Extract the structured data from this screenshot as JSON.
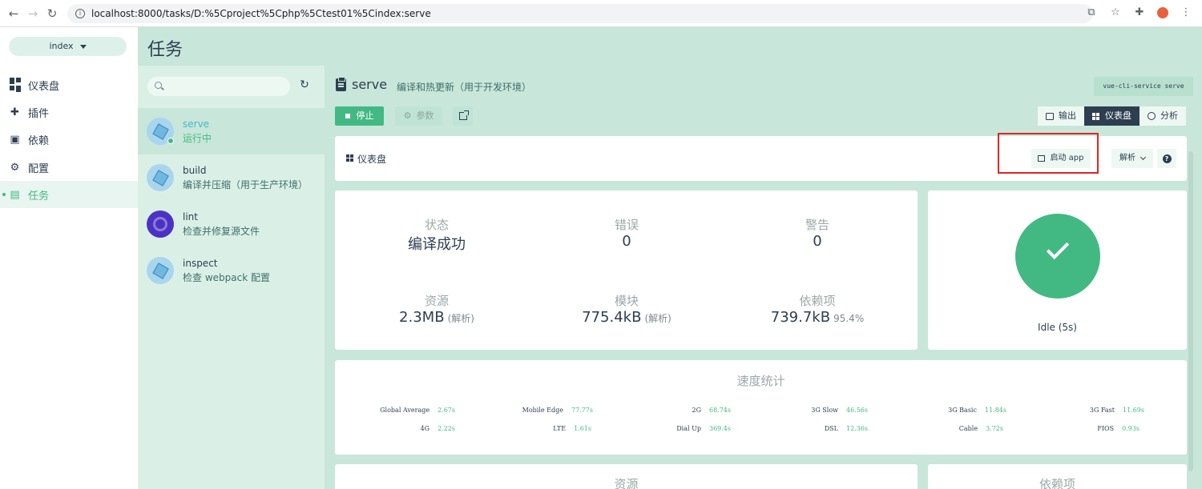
{
  "browser": {
    "url": "localhost:8000/tasks/D:%5Cproject%5Cphp%5Ctest01%5Cindex:serve"
  },
  "sidebar": {
    "project": "index",
    "items": [
      {
        "label": "仪表盘",
        "icon": "dashboard-icon"
      },
      {
        "label": "插件",
        "icon": "puzzle-icon"
      },
      {
        "label": "依赖",
        "icon": "library-icon"
      },
      {
        "label": "配置",
        "icon": "settings-icon"
      },
      {
        "label": "任务",
        "icon": "assignment-icon",
        "active": true
      }
    ]
  },
  "header": {
    "title": "任务"
  },
  "tasks": [
    {
      "name": "serve",
      "desc": "运行中",
      "active": true
    },
    {
      "name": "build",
      "desc": "编译并压缩（用于生产环境）"
    },
    {
      "name": "lint",
      "desc": "检查并修复源文件"
    },
    {
      "name": "inspect",
      "desc": "检查 webpack 配置"
    }
  ],
  "task": {
    "name": "serve",
    "desc": "编译和热更新（用于开发环境）",
    "command": "vue-cli-service serve",
    "stop_label": "停止",
    "params_label": "参数"
  },
  "view_tabs": [
    {
      "label": "输出"
    },
    {
      "label": "仪表盘",
      "active": true
    },
    {
      "label": "分析"
    }
  ],
  "dashboard": {
    "title": "仪表盘",
    "launch_label": "启动 app",
    "analyze_label": "解析",
    "highlight_color": "#e02424"
  },
  "stats": {
    "status": {
      "label": "状态",
      "value": "编译成功"
    },
    "errors": {
      "label": "错误",
      "value": "0"
    },
    "warnings": {
      "label": "警告",
      "value": "0"
    },
    "assets": {
      "label": "资源",
      "value": "2.3MB",
      "sub": "(解析)"
    },
    "modules": {
      "label": "模块",
      "value": "775.4kB",
      "sub": "(解析)"
    },
    "deps": {
      "label": "依赖项",
      "value": "739.7kB",
      "sub": "95.4%"
    }
  },
  "status_card": {
    "text": "Idle (5s)",
    "color": "#42b983"
  },
  "speed": {
    "title": "速度统计",
    "rows": [
      [
        {
          "name": "Global Average",
          "value": "2.67s"
        },
        {
          "name": "Mobile Edge",
          "value": "77.77s"
        },
        {
          "name": "2G",
          "value": "68.74s"
        },
        {
          "name": "3G Slow",
          "value": "46.56s"
        },
        {
          "name": "3G Basic",
          "value": "11.84s"
        },
        {
          "name": "3G Fast",
          "value": "11.69s"
        }
      ],
      [
        {
          "name": "4G",
          "value": "2.22s"
        },
        {
          "name": "LTE",
          "value": "1.61s"
        },
        {
          "name": "Dial Up",
          "value": "369.4s"
        },
        {
          "name": "DSL",
          "value": "12.36s"
        },
        {
          "name": "Cable",
          "value": "3.72s"
        },
        {
          "name": "FIOS",
          "value": "0.93s"
        }
      ]
    ]
  },
  "bottom": {
    "assets_title": "资源",
    "deps_title": "依赖项"
  },
  "colors": {
    "accent": "#42b983",
    "dark": "#2c3e50",
    "panel": "#c8e6da"
  }
}
